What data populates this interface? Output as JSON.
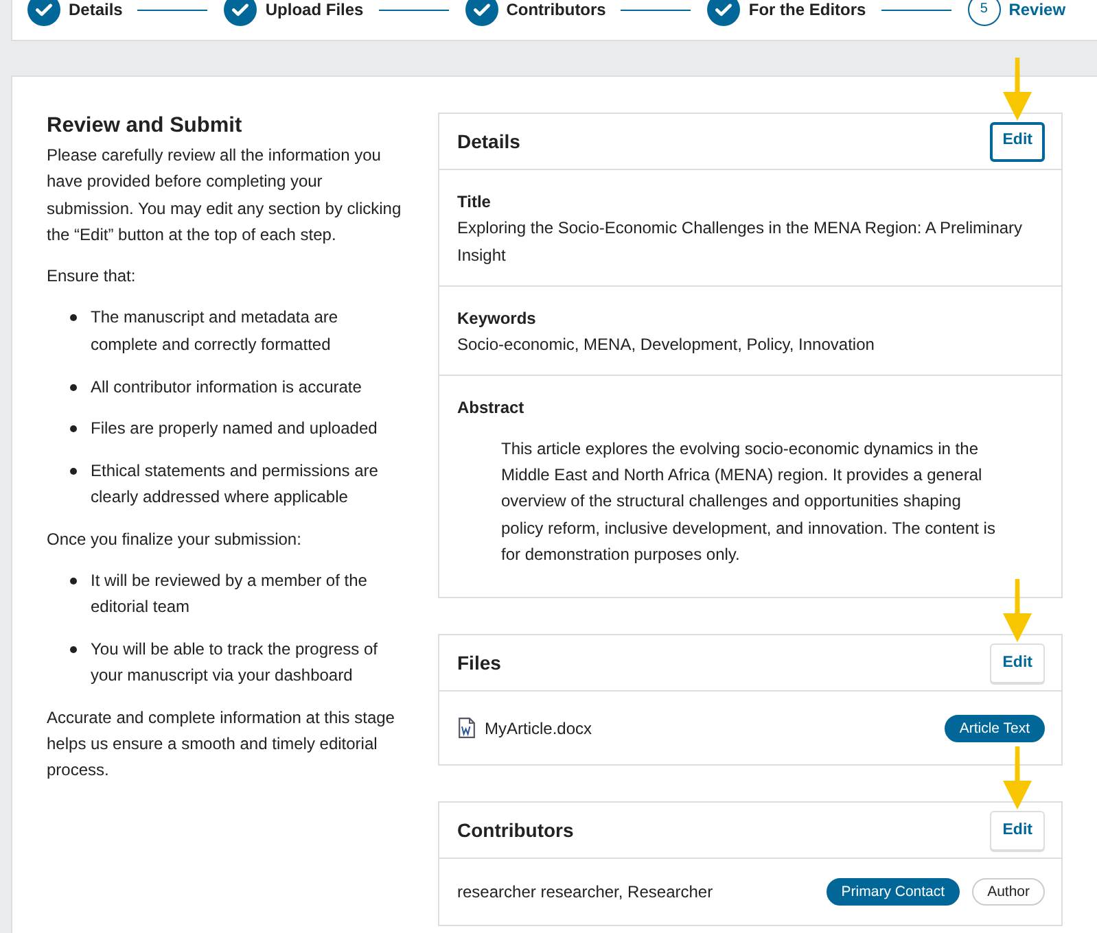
{
  "stepper": {
    "steps": [
      {
        "label": "Details",
        "completed": true,
        "current": false
      },
      {
        "label": "Upload Files",
        "completed": true,
        "current": false
      },
      {
        "label": "Contributors",
        "completed": true,
        "current": false
      },
      {
        "label": "For the Editors",
        "completed": true,
        "current": false
      },
      {
        "label": "Review",
        "completed": false,
        "current": true,
        "number": "5"
      }
    ]
  },
  "intro": {
    "heading": "Review and Submit",
    "blocks": [
      {
        "kind": "paragraph",
        "text": "Please carefully review all the information you have provided before completing your submission. You may edit any section by clicking the “Edit” button at the top of each step."
      },
      {
        "kind": "paragraph",
        "text": "Ensure that:"
      },
      {
        "kind": "list",
        "items": [
          "The manuscript and metadata are complete and correctly formatted",
          "All contributor information is accurate",
          "Files are properly named and uploaded",
          "Ethical statements and permissions are clearly addressed where applicable"
        ]
      },
      {
        "kind": "paragraph",
        "text": "Once you finalize your submission:"
      },
      {
        "kind": "list",
        "items": [
          "It will be reviewed by a member of the editorial team",
          "You will be able to track the progress of your manuscript via your dashboard"
        ]
      },
      {
        "kind": "paragraph",
        "text": "Accurate and complete information at this stage helps us ensure a smooth and timely editorial process."
      }
    ]
  },
  "sections": [
    {
      "kind": "fields",
      "title": "Details",
      "edit_button": {
        "label": "Edit",
        "focused": true,
        "annotation_arrow": true
      },
      "fields": [
        {
          "label": "Title",
          "value": "Exploring the Socio-Economic Challenges in the MENA Region: A Preliminary Insight",
          "indented": false
        },
        {
          "label": "Keywords",
          "value": "Socio-economic, MENA, Development, Policy, Innovation",
          "indented": false
        },
        {
          "label": "Abstract",
          "value": "This article explores the evolving socio-economic dynamics in the Middle East and North Africa (MENA) region. It provides a general overview of the structural challenges and opportunities shaping policy reform, inclusive development, and innovation. The content is for demonstration purposes only.",
          "indented": true
        }
      ]
    },
    {
      "kind": "files",
      "title": "Files",
      "edit_button": {
        "label": "Edit",
        "focused": false,
        "annotation_arrow": true
      },
      "files": [
        {
          "name": "MyArticle.docx",
          "tags": [
            {
              "label": "Article Text",
              "kind": "primary"
            }
          ]
        }
      ]
    },
    {
      "kind": "contributors",
      "title": "Contributors",
      "edit_button": {
        "label": "Edit",
        "focused": false,
        "annotation_arrow": true
      },
      "contributors": [
        {
          "name": "researcher researcher, Researcher",
          "roles": [
            {
              "label": "Primary Contact",
              "kind": "primary"
            },
            {
              "label": "Author",
              "kind": "secondary"
            }
          ]
        }
      ]
    }
  ]
}
